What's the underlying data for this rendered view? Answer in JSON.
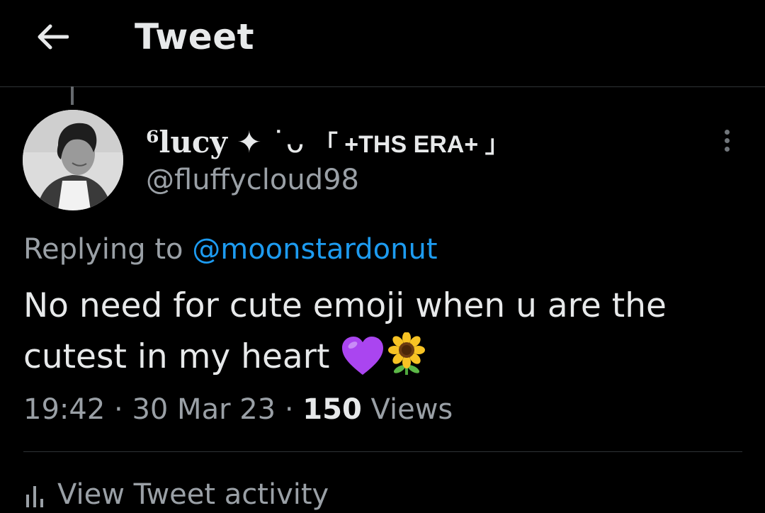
{
  "header": {
    "back_icon": "arrow-left-icon",
    "title": "Tweet"
  },
  "tweet": {
    "author": {
      "name_prefix": "⁶",
      "name_main": "lucy",
      "name_symbols": " ✦ ˙ᴗ ",
      "name_era": "「 +THS ERA+ 」",
      "handle": "@fluffycloud98",
      "avatar_icon": "profile-photo"
    },
    "more_icon": "more-vertical-icon",
    "reply": {
      "prefix": "Replying to ",
      "to": "@moonstardonut"
    },
    "text": "No need for cute emoji when u are the cutest in my heart",
    "emojis": [
      "purple-heart-icon",
      "sunflower-icon"
    ],
    "time": "19:42",
    "separator": " · ",
    "date": "30 Mar 23",
    "view_count": "150",
    "views_label": " Views"
  },
  "activity": {
    "icon": "analytics-icon",
    "label": "View Tweet activity"
  },
  "colors": {
    "background": "#000000",
    "text": "#e7e9ea",
    "muted": "#9aa0a6",
    "link": "#1d9bf0",
    "divider": "#2f3336"
  }
}
